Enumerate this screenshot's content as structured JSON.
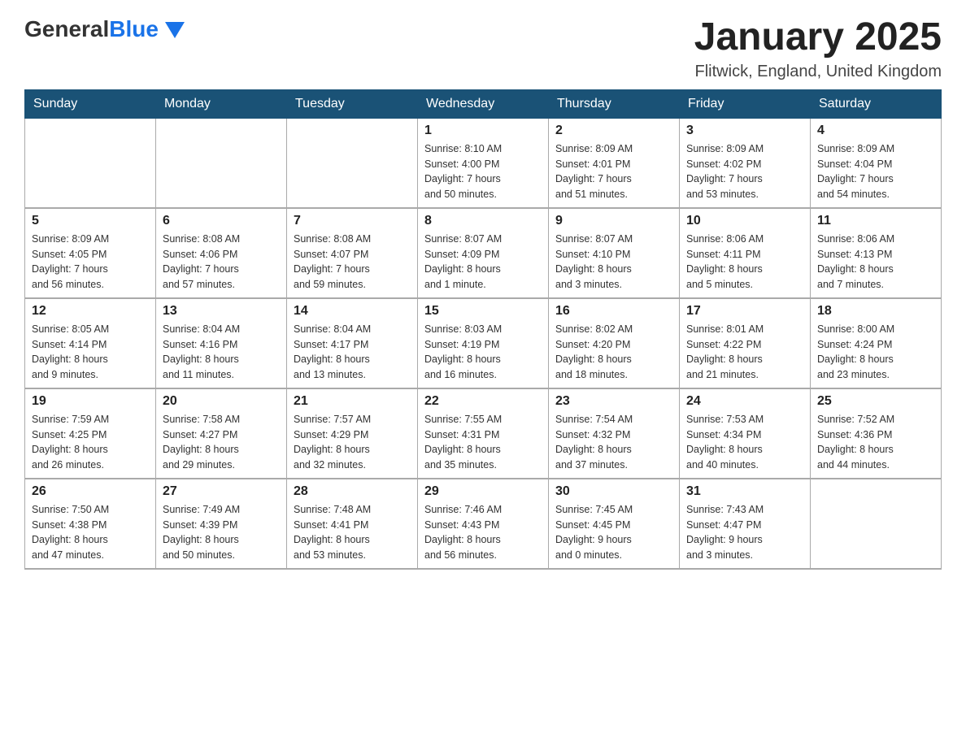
{
  "header": {
    "logo_general": "General",
    "logo_blue": "Blue",
    "title": "January 2025",
    "subtitle": "Flitwick, England, United Kingdom"
  },
  "days_of_week": [
    "Sunday",
    "Monday",
    "Tuesday",
    "Wednesday",
    "Thursday",
    "Friday",
    "Saturday"
  ],
  "weeks": [
    [
      {
        "num": "",
        "info": ""
      },
      {
        "num": "",
        "info": ""
      },
      {
        "num": "",
        "info": ""
      },
      {
        "num": "1",
        "info": "Sunrise: 8:10 AM\nSunset: 4:00 PM\nDaylight: 7 hours\nand 50 minutes."
      },
      {
        "num": "2",
        "info": "Sunrise: 8:09 AM\nSunset: 4:01 PM\nDaylight: 7 hours\nand 51 minutes."
      },
      {
        "num": "3",
        "info": "Sunrise: 8:09 AM\nSunset: 4:02 PM\nDaylight: 7 hours\nand 53 minutes."
      },
      {
        "num": "4",
        "info": "Sunrise: 8:09 AM\nSunset: 4:04 PM\nDaylight: 7 hours\nand 54 minutes."
      }
    ],
    [
      {
        "num": "5",
        "info": "Sunrise: 8:09 AM\nSunset: 4:05 PM\nDaylight: 7 hours\nand 56 minutes."
      },
      {
        "num": "6",
        "info": "Sunrise: 8:08 AM\nSunset: 4:06 PM\nDaylight: 7 hours\nand 57 minutes."
      },
      {
        "num": "7",
        "info": "Sunrise: 8:08 AM\nSunset: 4:07 PM\nDaylight: 7 hours\nand 59 minutes."
      },
      {
        "num": "8",
        "info": "Sunrise: 8:07 AM\nSunset: 4:09 PM\nDaylight: 8 hours\nand 1 minute."
      },
      {
        "num": "9",
        "info": "Sunrise: 8:07 AM\nSunset: 4:10 PM\nDaylight: 8 hours\nand 3 minutes."
      },
      {
        "num": "10",
        "info": "Sunrise: 8:06 AM\nSunset: 4:11 PM\nDaylight: 8 hours\nand 5 minutes."
      },
      {
        "num": "11",
        "info": "Sunrise: 8:06 AM\nSunset: 4:13 PM\nDaylight: 8 hours\nand 7 minutes."
      }
    ],
    [
      {
        "num": "12",
        "info": "Sunrise: 8:05 AM\nSunset: 4:14 PM\nDaylight: 8 hours\nand 9 minutes."
      },
      {
        "num": "13",
        "info": "Sunrise: 8:04 AM\nSunset: 4:16 PM\nDaylight: 8 hours\nand 11 minutes."
      },
      {
        "num": "14",
        "info": "Sunrise: 8:04 AM\nSunset: 4:17 PM\nDaylight: 8 hours\nand 13 minutes."
      },
      {
        "num": "15",
        "info": "Sunrise: 8:03 AM\nSunset: 4:19 PM\nDaylight: 8 hours\nand 16 minutes."
      },
      {
        "num": "16",
        "info": "Sunrise: 8:02 AM\nSunset: 4:20 PM\nDaylight: 8 hours\nand 18 minutes."
      },
      {
        "num": "17",
        "info": "Sunrise: 8:01 AM\nSunset: 4:22 PM\nDaylight: 8 hours\nand 21 minutes."
      },
      {
        "num": "18",
        "info": "Sunrise: 8:00 AM\nSunset: 4:24 PM\nDaylight: 8 hours\nand 23 minutes."
      }
    ],
    [
      {
        "num": "19",
        "info": "Sunrise: 7:59 AM\nSunset: 4:25 PM\nDaylight: 8 hours\nand 26 minutes."
      },
      {
        "num": "20",
        "info": "Sunrise: 7:58 AM\nSunset: 4:27 PM\nDaylight: 8 hours\nand 29 minutes."
      },
      {
        "num": "21",
        "info": "Sunrise: 7:57 AM\nSunset: 4:29 PM\nDaylight: 8 hours\nand 32 minutes."
      },
      {
        "num": "22",
        "info": "Sunrise: 7:55 AM\nSunset: 4:31 PM\nDaylight: 8 hours\nand 35 minutes."
      },
      {
        "num": "23",
        "info": "Sunrise: 7:54 AM\nSunset: 4:32 PM\nDaylight: 8 hours\nand 37 minutes."
      },
      {
        "num": "24",
        "info": "Sunrise: 7:53 AM\nSunset: 4:34 PM\nDaylight: 8 hours\nand 40 minutes."
      },
      {
        "num": "25",
        "info": "Sunrise: 7:52 AM\nSunset: 4:36 PM\nDaylight: 8 hours\nand 44 minutes."
      }
    ],
    [
      {
        "num": "26",
        "info": "Sunrise: 7:50 AM\nSunset: 4:38 PM\nDaylight: 8 hours\nand 47 minutes."
      },
      {
        "num": "27",
        "info": "Sunrise: 7:49 AM\nSunset: 4:39 PM\nDaylight: 8 hours\nand 50 minutes."
      },
      {
        "num": "28",
        "info": "Sunrise: 7:48 AM\nSunset: 4:41 PM\nDaylight: 8 hours\nand 53 minutes."
      },
      {
        "num": "29",
        "info": "Sunrise: 7:46 AM\nSunset: 4:43 PM\nDaylight: 8 hours\nand 56 minutes."
      },
      {
        "num": "30",
        "info": "Sunrise: 7:45 AM\nSunset: 4:45 PM\nDaylight: 9 hours\nand 0 minutes."
      },
      {
        "num": "31",
        "info": "Sunrise: 7:43 AM\nSunset: 4:47 PM\nDaylight: 9 hours\nand 3 minutes."
      },
      {
        "num": "",
        "info": ""
      }
    ]
  ]
}
